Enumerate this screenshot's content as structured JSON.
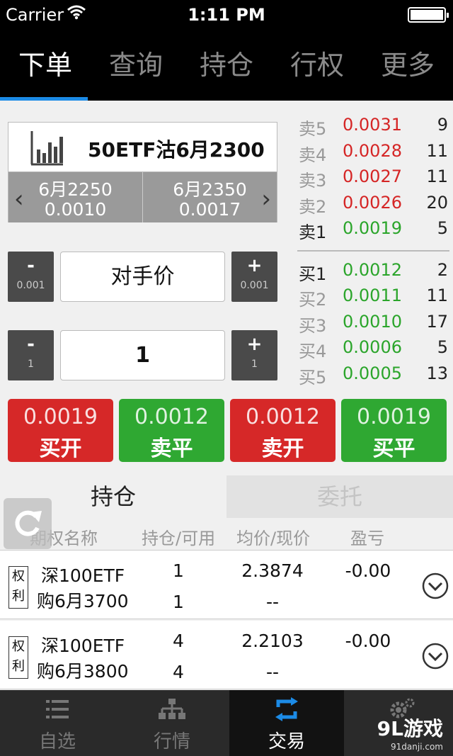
{
  "status_bar": {
    "carrier": "Carrier",
    "time": "1:11 PM"
  },
  "top_tabs": [
    {
      "label": "下单",
      "active": true
    },
    {
      "label": "查询",
      "active": false
    },
    {
      "label": "持仓",
      "active": false
    },
    {
      "label": "行权",
      "active": false
    },
    {
      "label": "更多",
      "active": false
    }
  ],
  "contract": {
    "name": "50ETF沽6月2300",
    "prev": {
      "name": "6月2250",
      "price": "0.0010"
    },
    "next": {
      "name": "6月2350",
      "price": "0.0017"
    }
  },
  "price_stepper": {
    "minus": "-",
    "minus_sub": "0.001",
    "value": "对手价",
    "plus": "+",
    "plus_sub": "0.001"
  },
  "qty_stepper": {
    "minus": "-",
    "minus_sub": "1",
    "value": "1",
    "plus": "+",
    "plus_sub": "1"
  },
  "order_book": {
    "asks": [
      {
        "label": "卖5",
        "price": "0.0031",
        "qty": "9",
        "color": "red"
      },
      {
        "label": "卖4",
        "price": "0.0028",
        "qty": "11",
        "color": "red"
      },
      {
        "label": "卖3",
        "price": "0.0027",
        "qty": "11",
        "color": "red"
      },
      {
        "label": "卖2",
        "price": "0.0026",
        "qty": "20",
        "color": "red"
      },
      {
        "label": "卖1",
        "price": "0.0019",
        "qty": "5",
        "color": "green"
      }
    ],
    "bids": [
      {
        "label": "买1",
        "price": "0.0012",
        "qty": "2",
        "color": "green"
      },
      {
        "label": "买2",
        "price": "0.0011",
        "qty": "11",
        "color": "green"
      },
      {
        "label": "买3",
        "price": "0.0010",
        "qty": "17",
        "color": "green"
      },
      {
        "label": "买4",
        "price": "0.0006",
        "qty": "5",
        "color": "green"
      },
      {
        "label": "买5",
        "price": "0.0005",
        "qty": "13",
        "color": "green"
      }
    ]
  },
  "trade_buttons": [
    {
      "price": "0.0019",
      "action": "买开",
      "color": "#d62828"
    },
    {
      "price": "0.0012",
      "action": "卖平",
      "color": "#2fa832"
    },
    {
      "price": "0.0012",
      "action": "卖开",
      "color": "#d62828"
    },
    {
      "price": "0.0019",
      "action": "买平",
      "color": "#2fa832"
    }
  ],
  "lower_tabs": {
    "positions": "持仓",
    "orders": "委托"
  },
  "table": {
    "headers": [
      "期权名称",
      "持仓/可用",
      "均价/现价",
      "盈亏"
    ],
    "rows": [
      {
        "tag1": "权",
        "tag2": "利",
        "name1": "深100ETF",
        "name2": "购6月3700",
        "hold": "1",
        "avail": "1",
        "avg": "2.3874",
        "cur": "--",
        "pnl": "-0.00"
      },
      {
        "tag1": "权",
        "tag2": "利",
        "name1": "深100ETF",
        "name2": "购6月3800",
        "hold": "4",
        "avail": "4",
        "avg": "2.2103",
        "cur": "--",
        "pnl": "-0.00"
      }
    ]
  },
  "bottom_nav": [
    {
      "label": "自选",
      "icon": "list-icon",
      "active": false
    },
    {
      "label": "行情",
      "icon": "hierarchy-icon",
      "active": false
    },
    {
      "label": "交易",
      "icon": "swap-icon",
      "active": true
    },
    {
      "label": "",
      "icon": "gear-icon",
      "active": false
    }
  ],
  "watermark": {
    "brand": "9L游戏",
    "site": "91danji.com"
  }
}
